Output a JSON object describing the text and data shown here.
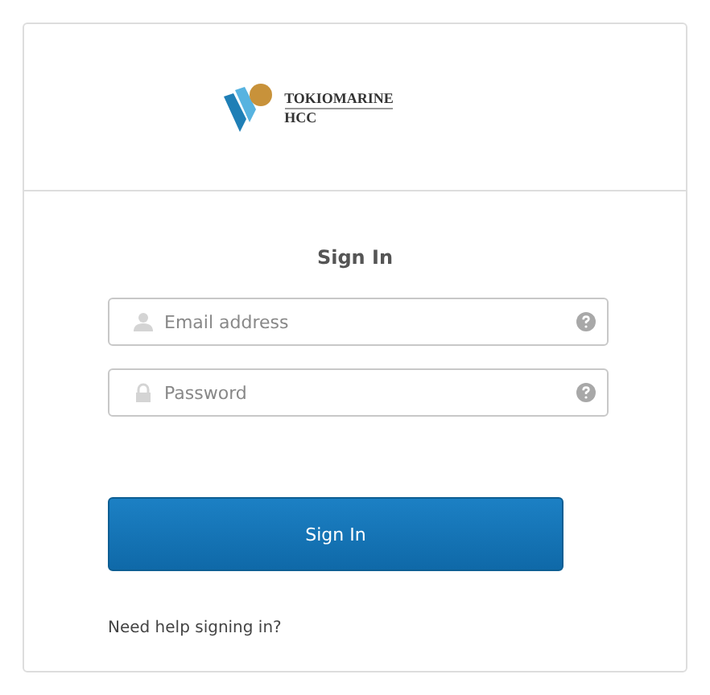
{
  "logo": {
    "line_1": "TOKIOMARINE",
    "line_2": "HCC"
  },
  "title": "Sign In",
  "fields": [
    {
      "kind": "user",
      "placeholder": "Email address"
    },
    {
      "kind": "lock",
      "placeholder": "Password"
    }
  ],
  "button": "Sign In",
  "help_link": "Need help signing in?"
}
